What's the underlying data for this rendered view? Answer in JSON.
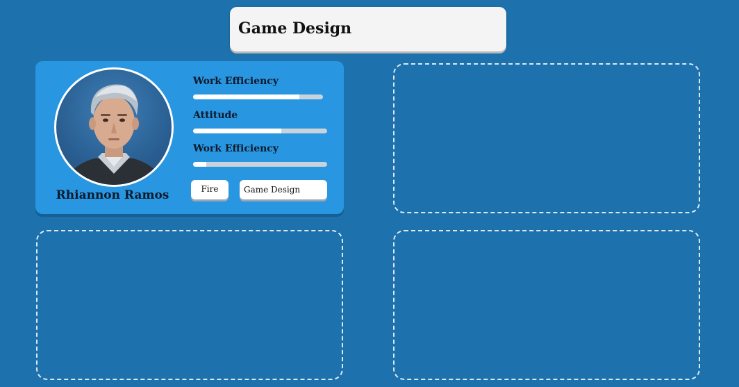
{
  "header": {
    "title": "Game Design"
  },
  "employee_card": {
    "name": "Rhiannon Ramos",
    "avatar_icon": "character-portrait",
    "stats": [
      {
        "label": "Work Efficiency",
        "value": 0.82
      },
      {
        "label": "Attitude",
        "value": 0.66
      },
      {
        "label": "Work Efficiency",
        "value": 0.1
      }
    ],
    "buttons": {
      "fire_label": "Fire",
      "department_label": "Game Design"
    }
  },
  "empty_slots": 3,
  "colors": {
    "background": "#1d72ad",
    "card": "#2896e0",
    "bar_fill": "#ffffff",
    "bar_track": "#c9d3dc",
    "slot_border": "#dfe9f3"
  }
}
